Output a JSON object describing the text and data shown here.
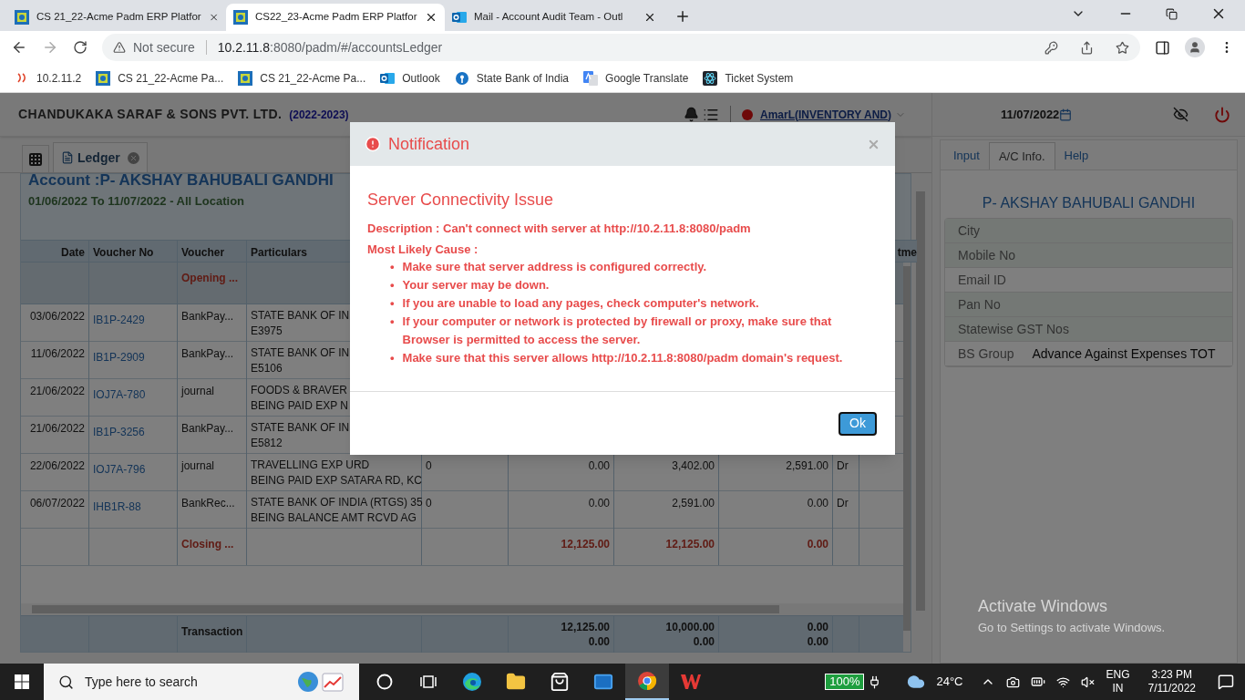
{
  "browser": {
    "tabs": [
      {
        "title": "CS 21_22-Acme Padm ERP Platfor",
        "selected": false,
        "kind": "erp"
      },
      {
        "title": "CS22_23-Acme Padm ERP Platfor",
        "selected": true,
        "kind": "erp"
      },
      {
        "title": "Mail - Account Audit Team - Outl",
        "selected": false,
        "kind": "mail"
      }
    ],
    "security": "Not secure",
    "url_host": "10.2.11.8",
    "url_path": ":8080/padm/#/accountsLedger",
    "bookmarks": [
      {
        "label": "10.2.11.2",
        "kind": "site"
      },
      {
        "label": "CS 21_22-Acme Pa...",
        "kind": "erp"
      },
      {
        "label": "CS 21_22-Acme Pa...",
        "kind": "erp"
      },
      {
        "label": "Outlook",
        "kind": "mail"
      },
      {
        "label": "State Bank of India",
        "kind": "bank"
      },
      {
        "label": "Google Translate",
        "kind": "translate"
      },
      {
        "label": "Ticket System",
        "kind": "react"
      }
    ]
  },
  "app": {
    "company": "CHANDUKAKA SARAF & SONS PVT. LTD.",
    "year": "(2022-2023)",
    "user": "AmarL(INVENTORY AND)",
    "date": "11/07/2022",
    "open_tab": "Ledger",
    "account_title": "Account :P- AKSHAY BAHUBALI GANDHI",
    "date_range": "01/06/2022 To 11/07/2022 - All Location",
    "table": {
      "columns": [
        "Date",
        "Voucher No",
        "Voucher",
        "Particulars"
      ],
      "column_10": "tme",
      "rows": [
        {
          "kind": "opening",
          "voucher": "Opening ..."
        },
        {
          "kind": "entry",
          "date": "03/06/2022",
          "voucher_no": "IB1P-2429",
          "voucher": "BankPay...",
          "particulars": [
            "STATE BANK OF IN",
            "E3975"
          ]
        },
        {
          "kind": "entry",
          "date": "11/06/2022",
          "voucher_no": "IB1P-2909",
          "voucher": "BankPay...",
          "particulars": [
            "STATE BANK OF IN",
            "E5106"
          ]
        },
        {
          "kind": "entry",
          "date": "21/06/2022",
          "voucher_no": "IOJ7A-780",
          "voucher": "journal",
          "particulars": [
            "FOODS & BRAVER",
            "BEING PAID EXP N"
          ]
        },
        {
          "kind": "entry",
          "date": "21/06/2022",
          "voucher_no": "IB1P-3256",
          "voucher": "BankPay...",
          "particulars": [
            "STATE BANK OF IN",
            "E5812"
          ]
        },
        {
          "kind": "entry",
          "date": "22/06/2022",
          "voucher_no": "IOJ7A-796",
          "voucher": "journal",
          "particulars": [
            "TRAVELLING EXP URD",
            "BEING PAID EXP SATARA RD, KC"
          ],
          "column_5": "0",
          "column_6": "0.00",
          "column_7": "3,402.00",
          "column_8": "2,591.00",
          "column_9": "Dr"
        },
        {
          "kind": "entry",
          "date": "06/07/2022",
          "voucher_no": "IHB1R-88",
          "voucher": "BankRec...",
          "particulars": [
            "STATE BANK OF INDIA (RTGS) 35",
            "BEING BALANCE AMT RCVD AG"
          ],
          "column_5": "0",
          "column_6": "0.00",
          "column_7": "2,591.00",
          "column_8": "0.00",
          "column_9": "Dr"
        },
        {
          "kind": "closing",
          "voucher": "Closing ...",
          "column_6": "12,125.00",
          "column_7": "12,125.00",
          "column_8": "0.00"
        }
      ],
      "footer": {
        "voucher": "Transaction",
        "column_6": [
          "12,125.00",
          "0.00"
        ],
        "column_7": [
          "10,000.00",
          "0.00"
        ],
        "column_8": [
          "0.00",
          "0.00"
        ]
      }
    },
    "side_tabs": [
      {
        "label": "Input",
        "selected": false
      },
      {
        "label": "A/C Info.",
        "selected": true
      },
      {
        "label": "Help",
        "selected": false
      }
    ],
    "account_name": "P- AKSHAY BAHUBALI GANDHI",
    "info": [
      {
        "label": "City"
      },
      {
        "label": "Mobile No"
      },
      {
        "label": "Email ID"
      },
      {
        "label": "Pan No"
      },
      {
        "label": "Statewise GST Nos"
      },
      {
        "label": "BS Group",
        "value": "Advance Against Expenses TOT"
      }
    ]
  },
  "modal": {
    "title": "Notification",
    "heading": "Server Connectivity Issue",
    "description": "Description : Can't connect with server at http://10.2.11.8:8080/padm",
    "cause_label": "Most Likely Cause :",
    "bullet": "•",
    "causes": [
      "Make sure that server address is configured correctly.",
      "Your server may be down.",
      "If you are unable to load any pages, check computer's network.",
      "If your computer or network is protected by firewall or proxy, make sure that Browser is permitted to access the server.",
      "Make sure that this server allows http://10.2.11.8:8080/padm domain's request."
    ],
    "button": "Ok"
  },
  "activation": {
    "title": "Activate Windows",
    "hint": "Go to Settings to activate Windows."
  },
  "taskbar": {
    "search_placeholder": "Type here to search",
    "apps": [
      {
        "kind": "cortana",
        "active": false
      },
      {
        "kind": "taskview",
        "active": false
      },
      {
        "kind": "edge",
        "active": false
      },
      {
        "kind": "explorer",
        "active": false
      },
      {
        "kind": "store",
        "active": false
      },
      {
        "kind": "mail",
        "active": false
      },
      {
        "kind": "chrome",
        "active": true
      },
      {
        "kind": "wps",
        "active": false
      }
    ],
    "battery": "100%",
    "temperature": "24°C",
    "language": "ENG",
    "region": "IN",
    "time": "3:23 PM",
    "date": "7/11/2022"
  }
}
